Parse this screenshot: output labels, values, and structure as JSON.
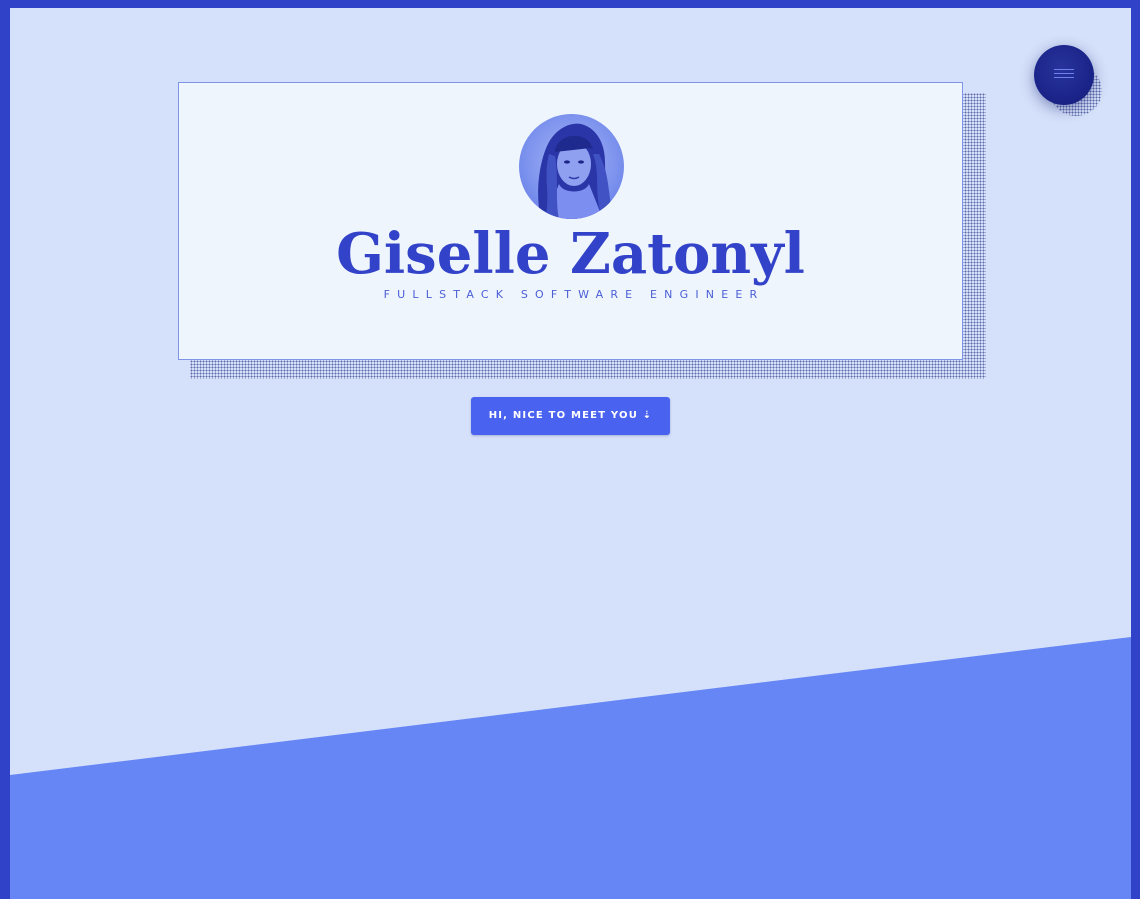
{
  "hero": {
    "name": "Giselle Zatonyl",
    "subtitle": "FULLSTACK SOFTWARE ENGINEER",
    "cta_label": "HI, NICE TO MEET YOU ⇣",
    "avatar_icon": "profile-photo"
  },
  "nav": {
    "menu_icon": "hamburger-menu-icon"
  },
  "theme": {
    "border": "#3043c8",
    "background": "#d5e1fa",
    "slant": "#6786f5",
    "card": "#eff5fd",
    "accent": "#3343c9",
    "button": "#4a62f0",
    "menu_button": "#1b2489"
  }
}
